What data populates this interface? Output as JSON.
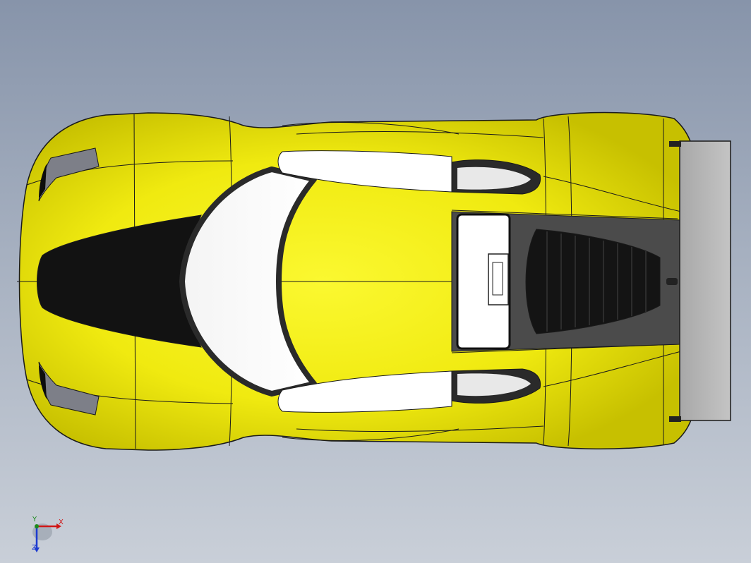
{
  "view": {
    "background_top": "#8794aa",
    "background_bottom": "#c9cfd8"
  },
  "model": {
    "body_color": "#f2ee10",
    "edge_color": "#1a1a1a",
    "glass_color": "#ffffff",
    "vent_color": "#111111",
    "wing_color": "#b9b9b9"
  },
  "triad": {
    "x_label": "X",
    "y_label": "Y",
    "z_label": "Z",
    "x_color": "#d01818",
    "y_color": "#1c8a1c",
    "z_color": "#1c3ad0",
    "icon": "coordinate-triad-icon"
  }
}
